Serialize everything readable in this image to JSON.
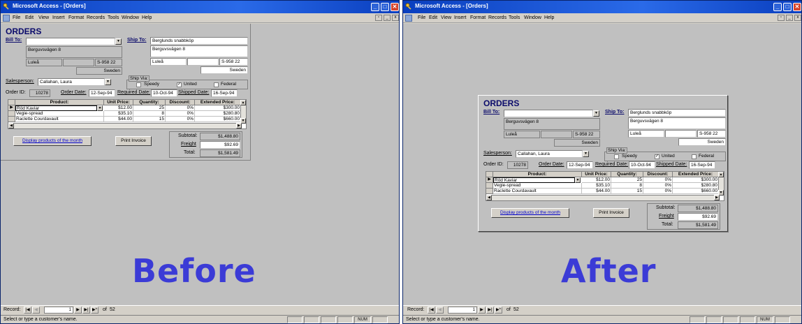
{
  "app": {
    "window_title": "Microsoft Access - [Orders]",
    "menu": [
      "File",
      "Edit",
      "View",
      "Insert",
      "Format",
      "Records",
      "Tools",
      "Window",
      "Help"
    ],
    "status_text": "Select or type a customer's name.",
    "num_indicator": "NUM",
    "nav": {
      "label": "Record:",
      "current": "1",
      "of_label": "of",
      "total": "52"
    }
  },
  "overlay": {
    "before": "Before",
    "after": "After"
  },
  "form": {
    "title": "ORDERS",
    "bill_to_label": "Bill To:",
    "bill_to_customer": "",
    "bill_address": "Berguvsvägen  8",
    "bill_city": "Luleå",
    "bill_region": "",
    "bill_postal": "S-958 22",
    "bill_country": "Sweden",
    "ship_to_label": "Ship To:",
    "ship_name": "Berglunds snabbköp",
    "ship_address": "Berguvsvägen  8",
    "ship_city": "Luleå",
    "ship_region": "",
    "ship_postal": "S-958 22",
    "ship_country": "Sweden",
    "salesperson_label": "Salesperson:",
    "salesperson": "Callahan, Laura",
    "ship_via_label": "Ship Via:",
    "ship_via": [
      {
        "label": "Speedy",
        "checked": false
      },
      {
        "label": "United",
        "checked": true
      },
      {
        "label": "Federal",
        "checked": false
      }
    ],
    "order_id_label": "Order ID:",
    "order_id": "10278",
    "order_date_label": "Order Date:",
    "order_date": "12-Sep-94",
    "required_date_label": "Required Date:",
    "required_date": "10-Oct-94",
    "shipped_date_label": "Shipped Date:",
    "shipped_date": "16-Sep-94",
    "columns": [
      "Product:",
      "Unit Price:",
      "Quantity:",
      "Discount:",
      "Extended Price:"
    ],
    "rows": [
      [
        "Röd Kaviar",
        "$12.00",
        "25",
        "0%",
        "$300.00"
      ],
      [
        "Vegie-spread",
        "$35.10",
        "8",
        "0%",
        "$280.80"
      ],
      [
        "Raclette Courdavault",
        "$44.00",
        "15",
        "0%",
        "$660.00"
      ]
    ],
    "display_button": "Display products of the month",
    "print_button": "Print Invoice",
    "subtotal_label": "Subtotal:",
    "subtotal": "$1,488.80",
    "freight_label": "Freight",
    "freight": "$92.69",
    "total_label": "Total:",
    "total": "$1,581.49"
  }
}
